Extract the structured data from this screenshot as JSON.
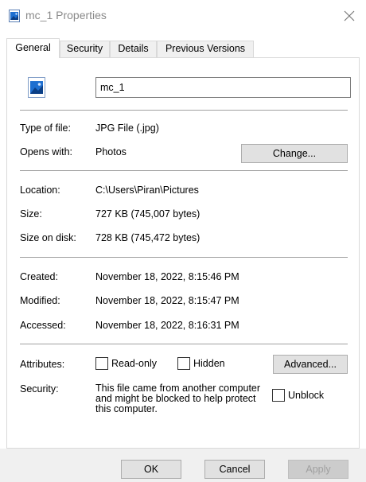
{
  "window": {
    "title": "mc_1 Properties",
    "icon": "image-file-icon",
    "close_icon": "close-icon"
  },
  "tabs": [
    {
      "label": "General",
      "active": true
    },
    {
      "label": "Security",
      "active": false
    },
    {
      "label": "Details",
      "active": false
    },
    {
      "label": "Previous Versions",
      "active": false
    }
  ],
  "general": {
    "file_icon": "image-file-icon",
    "file_name": "mc_1",
    "type_of_file_label": "Type of file:",
    "type_of_file_value": "JPG File (.jpg)",
    "opens_with_label": "Opens with:",
    "opens_with_value": "Photos",
    "change_button": "Change...",
    "location_label": "Location:",
    "location_value": "C:\\Users\\Piran\\Pictures",
    "size_label": "Size:",
    "size_value": "727 KB (745,007 bytes)",
    "size_on_disk_label": "Size on disk:",
    "size_on_disk_value": "728 KB (745,472 bytes)",
    "created_label": "Created:",
    "created_value": "November 18, 2022, 8:15:46 PM",
    "modified_label": "Modified:",
    "modified_value": "November 18, 2022, 8:15:47 PM",
    "accessed_label": "Accessed:",
    "accessed_value": "November 18, 2022, 8:16:31 PM",
    "attributes_label": "Attributes:",
    "readonly_label": "Read-only",
    "readonly_checked": false,
    "hidden_label": "Hidden",
    "hidden_checked": false,
    "advanced_button": "Advanced...",
    "security_label": "Security:",
    "security_text": "This file came from another computer and might be blocked to help protect this computer.",
    "unblock_label": "Unblock",
    "unblock_checked": false
  },
  "footer": {
    "ok_button": "OK",
    "cancel_button": "Cancel",
    "apply_button": "Apply"
  },
  "colors": {
    "accent_image_blue": "#1e6fd0",
    "title_text": "#8a8a8a",
    "footer_bg": "#f0f0f0",
    "button_bg": "#e1e1e1"
  }
}
